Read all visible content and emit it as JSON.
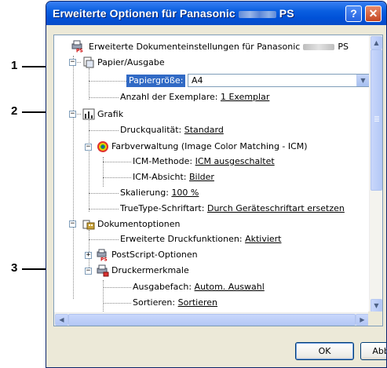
{
  "window": {
    "title_prefix": "Erweiterte Optionen für Panasonic",
    "title_suffix": "PS",
    "help_glyph": "?",
    "close_glyph": "✕"
  },
  "callouts": [
    "1",
    "2",
    "3"
  ],
  "tree": {
    "root": {
      "label": "Erweiterte Dokumenteinstellungen für Panasonic",
      "suffix": "PS",
      "icon": "printer-document-icon"
    },
    "paper": {
      "label": "Papier/Ausgabe",
      "icon": "paper-output-icon",
      "paper_size_label": "Papiergröße:",
      "paper_size_value": "A4",
      "copies_label": "Anzahl der Exemplare:",
      "copies_value": "1 Exemplar"
    },
    "graphics": {
      "label": "Grafik",
      "icon": "graphics-chart-icon",
      "quality_label": "Druckqualität:",
      "quality_value": "Standard",
      "color_label": "Farbverwaltung (Image Color Matching - ICM)",
      "color_icon": "color-wheel-icon",
      "icm_method_label": "ICM-Methode:",
      "icm_method_value": "ICM ausgeschaltet",
      "icm_intent_label": "ICM-Absicht:",
      "icm_intent_value": "Bilder",
      "scaling_label": "Skalierung:",
      "scaling_value": "100 %",
      "truetype_label": "TrueType-Schriftart:",
      "truetype_value": "Durch Geräteschriftart ersetzen"
    },
    "document": {
      "label": "Dokumentoptionen",
      "icon": "document-options-icon",
      "advanced_label": "Erweiterte Druckfunktionen:",
      "advanced_value": "Aktiviert",
      "postscript_label": "PostScript-Optionen",
      "postscript_icon": "postscript-icon",
      "features_label": "Druckermerkmale",
      "features_icon": "printer-features-icon",
      "tray_label": "Ausgabefach:",
      "tray_value": "Autom. Auswahl",
      "sort_label": "Sortieren:",
      "sort_value": "Sortieren"
    }
  },
  "buttons": {
    "ok": "OK",
    "cancel": "Abbrechen"
  },
  "colors": {
    "title_bar": "#0a5fe0",
    "highlight": "#c0005a",
    "selection": "#316ac5"
  }
}
